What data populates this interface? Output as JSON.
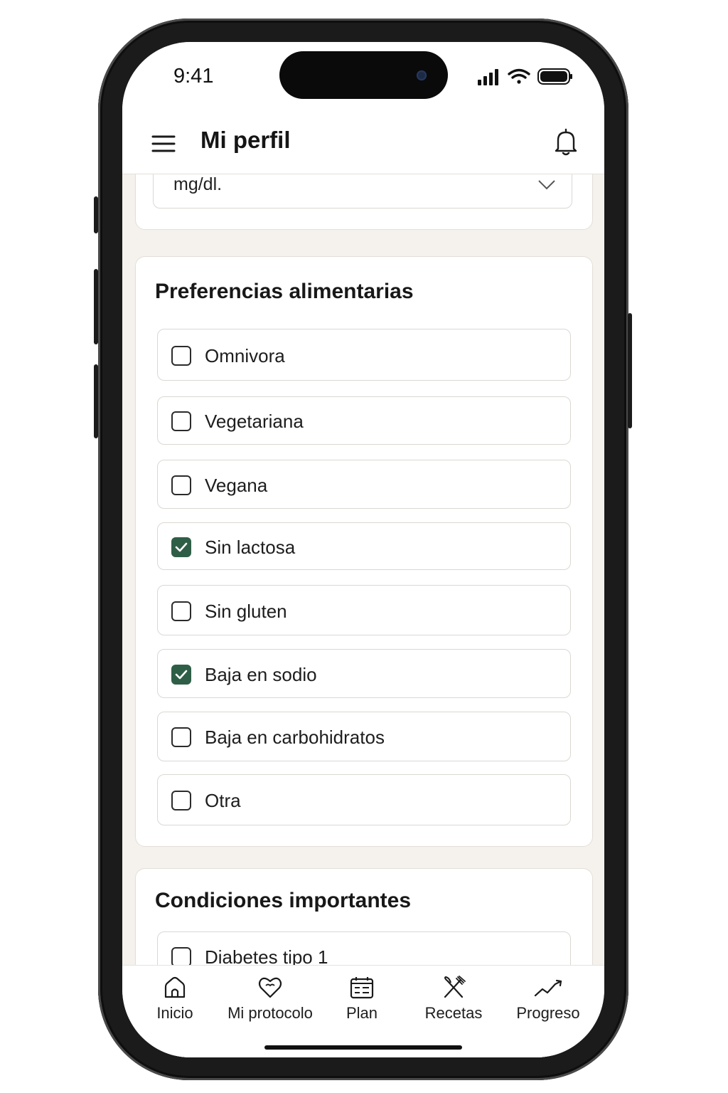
{
  "status_bar": {
    "time": "9:41"
  },
  "header": {
    "title": "Mi perfil"
  },
  "unit_select": {
    "value": "mg/dl."
  },
  "preferences": {
    "title": "Preferencias alimentarias",
    "options": [
      {
        "label": "Omnivora",
        "checked": false
      },
      {
        "label": "Vegetariana",
        "checked": false
      },
      {
        "label": "Vegana",
        "checked": false
      },
      {
        "label": "Sin lactosa",
        "checked": true
      },
      {
        "label": "Sin gluten",
        "checked": false
      },
      {
        "label": "Baja en sodio",
        "checked": true
      },
      {
        "label": "Baja en carbohidratos",
        "checked": false
      },
      {
        "label": "Otra",
        "checked": false
      }
    ]
  },
  "conditions": {
    "title": "Condiciones importantes",
    "options": [
      {
        "label": "Diabetes tipo 1",
        "checked": false
      }
    ]
  },
  "bottom_nav": {
    "items": [
      {
        "label": "Inicio",
        "icon": "home-icon"
      },
      {
        "label": "Mi protocolo",
        "icon": "heart-icon"
      },
      {
        "label": "Plan",
        "icon": "calendar-list-icon"
      },
      {
        "label": "Recetas",
        "icon": "utensils-icon"
      },
      {
        "label": "Progreso",
        "icon": "trend-icon"
      }
    ]
  },
  "colors": {
    "accent": "#2f5e47",
    "background": "#f5f2ee",
    "card": "#ffffff"
  }
}
